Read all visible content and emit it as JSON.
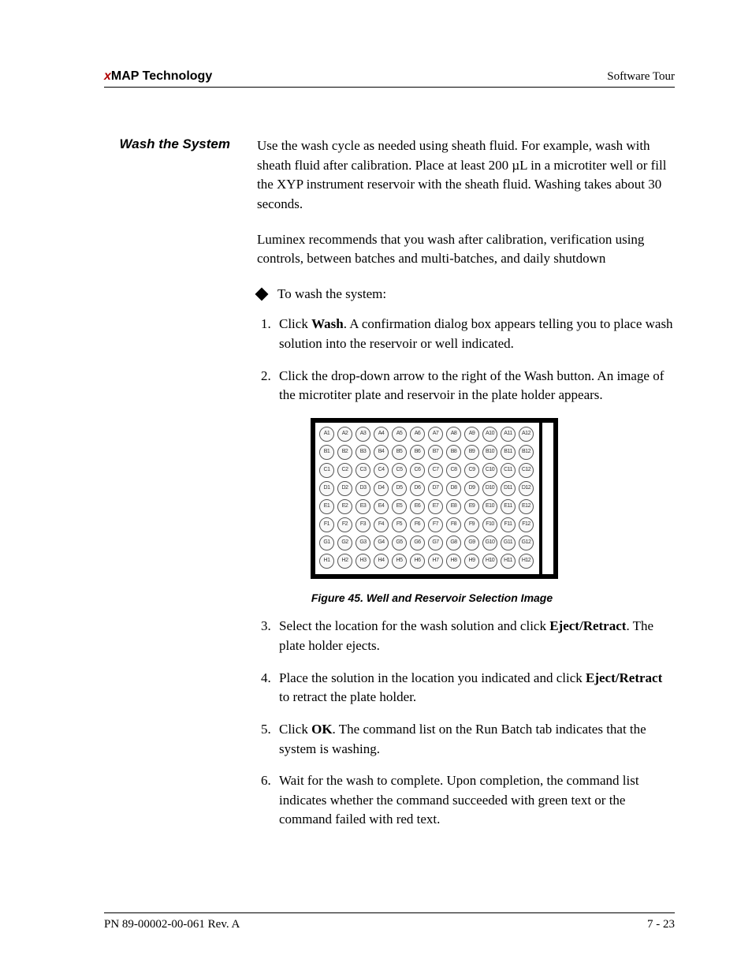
{
  "header": {
    "brand_prefix": "x",
    "brand": "MAP Technology",
    "right": "Software Tour"
  },
  "section_title": "Wash the System",
  "para1": "Use the wash cycle as needed using sheath fluid. For example, wash with sheath fluid after calibration. Place at least 200 µL in a microtiter well or fill the XYP instrument reservoir with the sheath fluid. Washing takes about 30 seconds.",
  "para2": "Luminex recommends that you wash after calibration, verification using controls, between batches and multi-batches, and daily shutdown",
  "bullet": "To wash the system:",
  "steps": {
    "s1a": "Click ",
    "s1b": "Wash",
    "s1c": ". A confirmation dialog box appears telling you to place wash solution into the reservoir or well indicated.",
    "s2": "Click the drop-down arrow to the right of the Wash button. An image of the microtiter plate and reservoir in the plate holder appears.",
    "s3a": "Select the location for the wash solution and click ",
    "s3b": "Eject/Retract",
    "s3c": ". The plate holder ejects.",
    "s4a": "Place the solution in the location you indicated and click ",
    "s4b": "Eject/Retract",
    "s4c": " to retract the plate holder.",
    "s5a": "Click ",
    "s5b": "OK",
    "s5c": ". The command list on the Run Batch tab indicates that the system is washing.",
    "s6": "Wait for the wash to complete. Upon completion, the command list indicates whether the command succeeded with green text or the command failed with red text."
  },
  "plate": {
    "rows": [
      "A",
      "B",
      "C",
      "D",
      "E",
      "F",
      "G",
      "H"
    ],
    "cols": [
      1,
      2,
      3,
      4,
      5,
      6,
      7,
      8,
      9,
      10,
      11,
      12
    ]
  },
  "figure_caption": "Figure 45.  Well and Reservoir Selection Image",
  "footer": {
    "left": "PN 89-00002-00-061 Rev. A",
    "right": "7 - 23"
  }
}
